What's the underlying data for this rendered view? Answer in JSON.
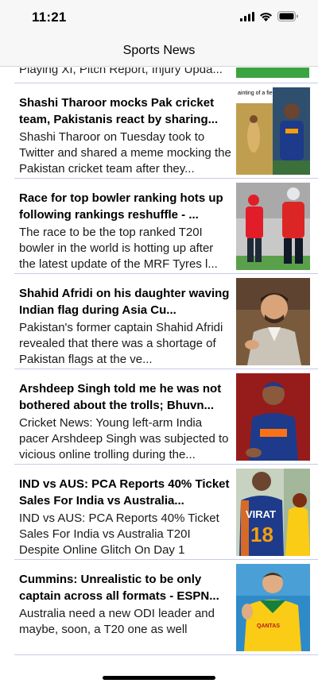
{
  "status_bar": {
    "time": "11:21"
  },
  "nav": {
    "title": "Sports News"
  },
  "feed": {
    "partial_item": {
      "summary": "Playing XI, Pitch Report, Injury Upda..."
    },
    "items": [
      {
        "headline": "Shashi Tharoor mocks Pak cricket team, Pakistanis react by sharing...",
        "summary": "Shashi Tharoor on Tuesday took to Twitter and shared a meme mocking the Pakistan cricket team after they...",
        "image_caption": "ainting of a fielder"
      },
      {
        "headline": "Race for top bowler ranking hots up following rankings reshuffle - ...",
        "summary": "The race to be the top ranked T20I bowler in the world is hotting up after the latest update of the MRF Tyres l..."
      },
      {
        "headline": "Shahid Afridi on his daughter waving Indian flag during Asia Cu...",
        "summary": "Pakistan's former captain Shahid Afridi revealed that there was a shortage of Pakistan flags at the ve..."
      },
      {
        "headline": "Arshdeep Singh told me he was not bothered about the trolls; Bhuvn...",
        "summary": "Cricket News: Young left-arm India pacer Arshdeep Singh was subjected to vicious online trolling during the..."
      },
      {
        "headline": "IND vs AUS: PCA Reports 40% Ticket Sales For India vs Australia...",
        "summary": "IND vs AUS: PCA Reports 40% Ticket Sales For India vs Australia T20I Despite Online Glitch On Day 1",
        "image_text": "VIRAT",
        "image_number": "18"
      },
      {
        "headline": "Cummins: Unrealistic to be only captain across all formats - ESPN...",
        "summary": "Australia need a new ODI leader and maybe, soon, a T20 one as well",
        "image_text": "QANTAS"
      }
    ]
  }
}
